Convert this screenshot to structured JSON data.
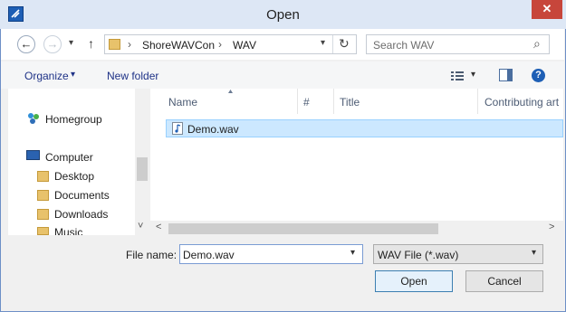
{
  "window": {
    "title": "Open",
    "close_glyph": "✕"
  },
  "navigation": {
    "back_glyph": "←",
    "forward_glyph": "→",
    "recent_glyph": "▾",
    "up_glyph": "↑",
    "path": [
      "ShoreWAVCon",
      "WAV"
    ],
    "separator_glyph": "›",
    "dropdown_glyph": "▾",
    "refresh_glyph": "↻",
    "search_placeholder": "Search WAV",
    "search_glyph": "⌕"
  },
  "toolbar": {
    "organize_label": "Organize",
    "organize_arrow": "▾",
    "new_folder_label": "New folder",
    "view_arrow": "▾",
    "help_glyph": "?"
  },
  "sidebar": {
    "homegroup": "Homegroup",
    "computer": "Computer",
    "items": [
      "Desktop",
      "Documents",
      "Downloads",
      "Music"
    ],
    "scroll_down_glyph": "˅"
  },
  "file_list": {
    "columns": [
      "Name",
      "#",
      "Title",
      "Contributing art"
    ],
    "sort_indicator": "^",
    "files": [
      {
        "name": "Demo.wav"
      }
    ],
    "scroll_left_glyph": "<",
    "scroll_right_glyph": ">"
  },
  "footer": {
    "file_name_label": "File name:",
    "file_name_value": "Demo.wav",
    "file_name_arrow": "▾",
    "file_type_value": "WAV File (*.wav)",
    "file_type_arrow": "▾",
    "open_label": "Open",
    "cancel_label": "Cancel"
  },
  "colors": {
    "accent": "#1e5fb5",
    "selection": "#cce8ff",
    "selection_border": "#99d1ff",
    "close": "#c7463b"
  }
}
